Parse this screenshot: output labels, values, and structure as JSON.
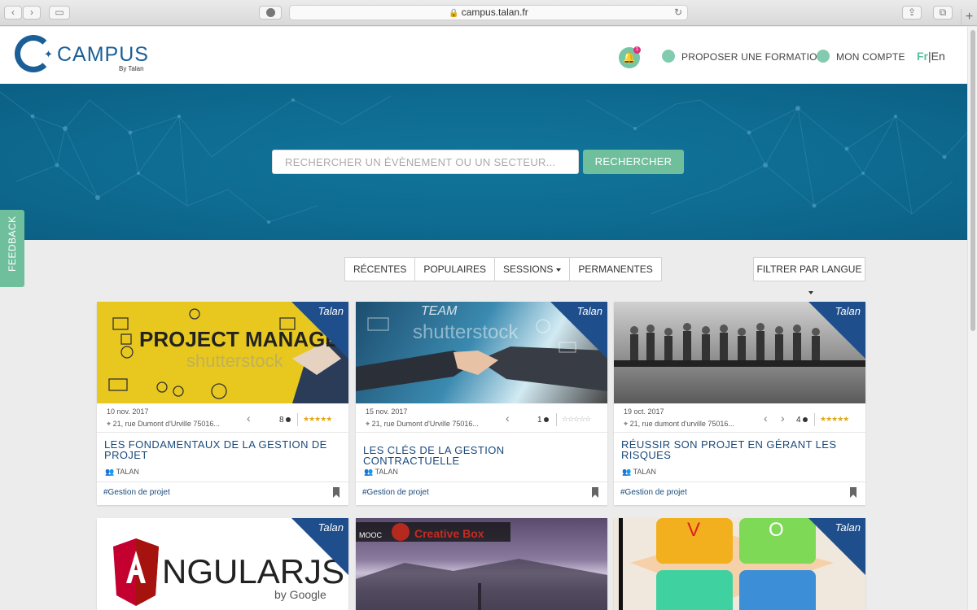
{
  "browser": {
    "url": "campus.talan.fr"
  },
  "header": {
    "logo_text": "CAMPUS",
    "logo_by": "By Talan",
    "notification_count": "1",
    "propose_label": "PROPOSER UNE FORMATION",
    "account_label": "MON COMPTE",
    "lang_fr": "Fr",
    "lang_sep": "|",
    "lang_en": "En"
  },
  "hero": {
    "search_placeholder": "RECHERCHER UN ÉVÈNEMENT OU UN SECTEUR...",
    "search_button": "RECHERCHER"
  },
  "feedback": "FEEDBACK",
  "filters": {
    "tabs": [
      "RÉCENTES",
      "POPULAIRES",
      "SESSIONS",
      "PERMANENTES"
    ],
    "language_filter": "FILTRER PAR LANGUE"
  },
  "colors": {
    "brand": "#1a5f97",
    "accent": "#6fbe9c",
    "hero": "#0e6a90",
    "badge": "#e0307f"
  },
  "cards": [
    {
      "date": "10 nov. 2017",
      "address": "21, rue Dumont d'Urville 75016...",
      "comments": "8",
      "rating": 5,
      "title": "LES FONDAMENTAUX DE LA GESTION DE PROJET",
      "organizer": "TALAN",
      "tag": "#Gestion de projet",
      "image_text": "PROJECT MANAGEMENT",
      "badge": "Talan"
    },
    {
      "date": "15 nov. 2017",
      "address": "21, rue Dumont d'Urville 75016...",
      "comments": "1",
      "rating": 0,
      "title": "LES CLÉS DE LA GESTION CONTRACTUELLE",
      "organizer": "TALAN",
      "tag": "#Gestion de projet",
      "image_text": "shutterstock",
      "badge": "Talan"
    },
    {
      "date": "19 oct. 2017",
      "address": "21, rue dumont d'urville 75016...",
      "comments": "4",
      "rating": 5,
      "title": "RÉUSSIR SON PROJET EN GÉRANT LES RISQUES",
      "organizer": "TALAN",
      "tag": "#Gestion de projet",
      "badge": "Talan"
    }
  ],
  "cards_row2": [
    {
      "image_text": "NGULARJS",
      "image_sub": "by Google",
      "badge": "Talan"
    },
    {
      "image_text": "Creative Box",
      "image_sub": "MOOC"
    },
    {
      "image_text": "V",
      "image_sub": "O",
      "badge": "Talan"
    }
  ]
}
